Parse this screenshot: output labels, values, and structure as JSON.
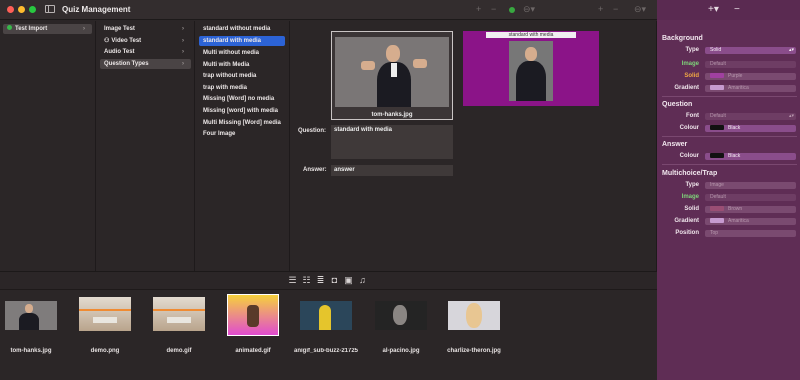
{
  "window": {
    "title": "Quiz Management"
  },
  "browser": {
    "col1": [
      {
        "label": "Test Import",
        "status": "green"
      }
    ],
    "col2": [
      {
        "label": "Image Test"
      },
      {
        "label": "Video Test"
      },
      {
        "label": "Audio Test"
      },
      {
        "label": "Question Types"
      }
    ],
    "col3": [
      {
        "label": "standard without media"
      },
      {
        "label": "standard with media"
      },
      {
        "label": "Multi without media"
      },
      {
        "label": "Multi with Media"
      },
      {
        "label": "trap without media"
      },
      {
        "label": "trap with media"
      },
      {
        "label": "Missing [Word] no media"
      },
      {
        "label": "Missing [word] with media"
      },
      {
        "label": "Multi Missing [Word] media"
      },
      {
        "label": "Four Image"
      }
    ]
  },
  "detail": {
    "preview_filename": "tom-hanks.jpg",
    "rendered_question_title": "standard with media",
    "question_label": "Question:",
    "question_value": "standard with media",
    "answer_label": "Answer:",
    "answer_value": "answer"
  },
  "media": {
    "items": [
      {
        "name": "tom-hanks.jpg",
        "kind": "person",
        "bg": "#7f7c7c"
      },
      {
        "name": "demo.png",
        "kind": "desk",
        "bg": "#c9c1b6"
      },
      {
        "name": "demo.gif",
        "kind": "desk",
        "bg": "#c9c1b6"
      },
      {
        "name": "animated.gif",
        "kind": "cartoon",
        "bg": "#f2c43f"
      },
      {
        "name": "anigif_sub-buzz-21725",
        "kind": "minion",
        "bg": "#2b465a"
      },
      {
        "name": "al-pacino.jpg",
        "kind": "bw",
        "bg": "#242424"
      },
      {
        "name": "charlize-theron.jpg",
        "kind": "woman",
        "bg": "#d7d6db"
      }
    ]
  },
  "inspector": {
    "background_title": "Background",
    "type_label": "Type",
    "type_value": "Solid",
    "image_label": "Image",
    "image_value": "Default",
    "solid_label": "Solid",
    "solid_value": "Purple",
    "gradient_label": "Gradient",
    "gradient_value": "Amaritica",
    "question_title": "Question",
    "font_label": "Font",
    "font_value": "Default",
    "colour_label": "Colour",
    "q_colour_value": "Black",
    "answer_title": "Answer",
    "a_colour_value": "Black",
    "multichoice_title": "Multichoice/Trap",
    "m_type_value": "Image",
    "m_image_value": "Default",
    "m_solid_value": "Brown",
    "m_gradient_value": "Amaritica",
    "position_label": "Position",
    "position_value": "Top"
  },
  "colors": {
    "accent": "#2c63d6",
    "purple": "#8b1488",
    "panel": "#5f2d55"
  }
}
